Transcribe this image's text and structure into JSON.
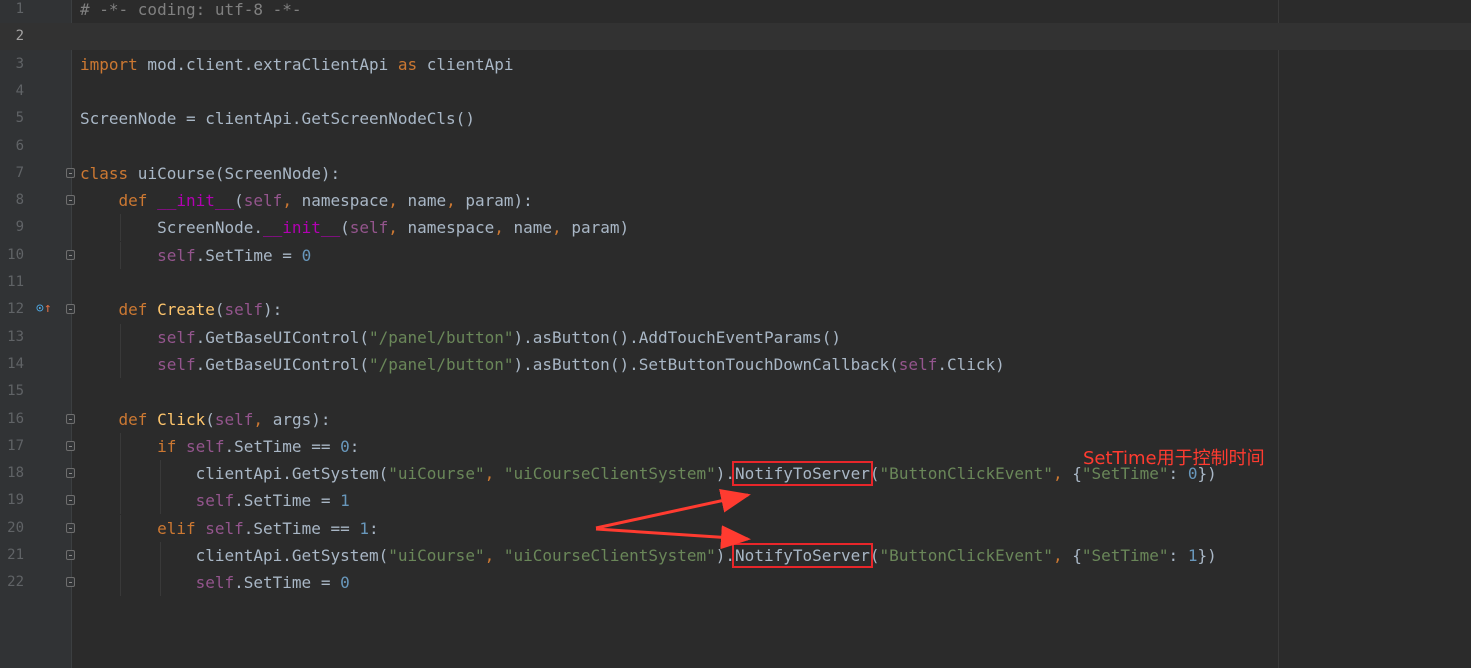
{
  "editor": {
    "current_line": 2,
    "lines": [
      {
        "n": "1",
        "tokens": [
          {
            "t": "cm",
            "v": "# -*- coding: utf-8 -*-"
          }
        ]
      },
      {
        "n": "2",
        "tokens": []
      },
      {
        "n": "3",
        "tokens": [
          {
            "t": "kw",
            "v": "import"
          },
          {
            "t": "",
            "v": " mod.client.extraClientApi "
          },
          {
            "t": "kw",
            "v": "as"
          },
          {
            "t": "",
            "v": " clientApi"
          }
        ]
      },
      {
        "n": "4",
        "tokens": []
      },
      {
        "n": "5",
        "tokens": [
          {
            "t": "",
            "v": "ScreenNode = clientApi.GetScreenNodeCls()"
          }
        ]
      },
      {
        "n": "6",
        "tokens": []
      },
      {
        "n": "7",
        "tokens": [
          {
            "t": "kw",
            "v": "class"
          },
          {
            "t": "",
            "v": " uiCourse(ScreenNode):"
          }
        ]
      },
      {
        "n": "8",
        "tokens": [
          {
            "t": "",
            "v": "    "
          },
          {
            "t": "kw",
            "v": "def"
          },
          {
            "t": "",
            "v": " "
          },
          {
            "t": "dn",
            "v": "__init__"
          },
          {
            "t": "",
            "v": "("
          },
          {
            "t": "sf",
            "v": "self"
          },
          {
            "t": "kw",
            "v": ","
          },
          {
            "t": "",
            "v": " namespace"
          },
          {
            "t": "kw",
            "v": ","
          },
          {
            "t": "",
            "v": " name"
          },
          {
            "t": "kw",
            "v": ","
          },
          {
            "t": "",
            "v": " param):"
          }
        ]
      },
      {
        "n": "9",
        "tokens": [
          {
            "t": "",
            "v": "        ScreenNode."
          },
          {
            "t": "dn",
            "v": "__init__"
          },
          {
            "t": "",
            "v": "("
          },
          {
            "t": "sf",
            "v": "self"
          },
          {
            "t": "kw",
            "v": ","
          },
          {
            "t": "",
            "v": " namespace"
          },
          {
            "t": "kw",
            "v": ","
          },
          {
            "t": "",
            "v": " name"
          },
          {
            "t": "kw",
            "v": ","
          },
          {
            "t": "",
            "v": " param)"
          }
        ]
      },
      {
        "n": "10",
        "tokens": [
          {
            "t": "",
            "v": "        "
          },
          {
            "t": "sf",
            "v": "self"
          },
          {
            "t": "",
            "v": ".SetTime = "
          },
          {
            "t": "nu",
            "v": "0"
          }
        ]
      },
      {
        "n": "11",
        "tokens": []
      },
      {
        "n": "12",
        "tokens": [
          {
            "t": "",
            "v": "    "
          },
          {
            "t": "kw",
            "v": "def"
          },
          {
            "t": "",
            "v": " "
          },
          {
            "t": "fn",
            "v": "Create"
          },
          {
            "t": "",
            "v": "("
          },
          {
            "t": "sf",
            "v": "self"
          },
          {
            "t": "",
            "v": "):"
          }
        ]
      },
      {
        "n": "13",
        "tokens": [
          {
            "t": "",
            "v": "        "
          },
          {
            "t": "sf",
            "v": "self"
          },
          {
            "t": "",
            "v": ".GetBaseUIControl("
          },
          {
            "t": "st",
            "v": "\"/panel/button\""
          },
          {
            "t": "",
            "v": ").asButton().AddTouchEventParams()"
          }
        ]
      },
      {
        "n": "14",
        "tokens": [
          {
            "t": "",
            "v": "        "
          },
          {
            "t": "sf",
            "v": "self"
          },
          {
            "t": "",
            "v": ".GetBaseUIControl("
          },
          {
            "t": "st",
            "v": "\"/panel/button\""
          },
          {
            "t": "",
            "v": ").asButton().SetButtonTouchDownCallback("
          },
          {
            "t": "sf",
            "v": "self"
          },
          {
            "t": "",
            "v": ".Click)"
          }
        ]
      },
      {
        "n": "15",
        "tokens": []
      },
      {
        "n": "16",
        "tokens": [
          {
            "t": "",
            "v": "    "
          },
          {
            "t": "kw",
            "v": "def"
          },
          {
            "t": "",
            "v": " "
          },
          {
            "t": "fn",
            "v": "Click"
          },
          {
            "t": "",
            "v": "("
          },
          {
            "t": "sf",
            "v": "self"
          },
          {
            "t": "kw",
            "v": ","
          },
          {
            "t": "",
            "v": " args):"
          }
        ]
      },
      {
        "n": "17",
        "tokens": [
          {
            "t": "",
            "v": "        "
          },
          {
            "t": "kw",
            "v": "if"
          },
          {
            "t": "",
            "v": " "
          },
          {
            "t": "sf",
            "v": "self"
          },
          {
            "t": "",
            "v": ".SetTime == "
          },
          {
            "t": "nu",
            "v": "0"
          },
          {
            "t": "",
            "v": ":"
          }
        ]
      },
      {
        "n": "18",
        "tokens": [
          {
            "t": "",
            "v": "            clientApi.GetSystem("
          },
          {
            "t": "st",
            "v": "\"uiCourse\""
          },
          {
            "t": "kw",
            "v": ","
          },
          {
            "t": "",
            "v": " "
          },
          {
            "t": "st",
            "v": "\"uiCourseClientSystem\""
          },
          {
            "t": "",
            "v": ")."
          },
          {
            "t": "hl",
            "v": "NotifyToServer"
          },
          {
            "t": "",
            "v": "("
          },
          {
            "t": "st",
            "v": "\"ButtonClickEvent\""
          },
          {
            "t": "kw",
            "v": ","
          },
          {
            "t": "",
            "v": " {"
          },
          {
            "t": "st",
            "v": "\"SetTime\""
          },
          {
            "t": "",
            "v": ": "
          },
          {
            "t": "nu",
            "v": "0"
          },
          {
            "t": "",
            "v": "})"
          }
        ]
      },
      {
        "n": "19",
        "tokens": [
          {
            "t": "",
            "v": "            "
          },
          {
            "t": "sf",
            "v": "self"
          },
          {
            "t": "",
            "v": ".SetTime = "
          },
          {
            "t": "nu",
            "v": "1"
          }
        ]
      },
      {
        "n": "20",
        "tokens": [
          {
            "t": "",
            "v": "        "
          },
          {
            "t": "kw",
            "v": "elif"
          },
          {
            "t": "",
            "v": " "
          },
          {
            "t": "sf",
            "v": "self"
          },
          {
            "t": "",
            "v": ".SetTime == "
          },
          {
            "t": "nu",
            "v": "1"
          },
          {
            "t": "",
            "v": ":"
          }
        ]
      },
      {
        "n": "21",
        "tokens": [
          {
            "t": "",
            "v": "            clientApi.GetSystem("
          },
          {
            "t": "st",
            "v": "\"uiCourse\""
          },
          {
            "t": "kw",
            "v": ","
          },
          {
            "t": "",
            "v": " "
          },
          {
            "t": "st",
            "v": "\"uiCourseClientSystem\""
          },
          {
            "t": "",
            "v": ")."
          },
          {
            "t": "hl",
            "v": "NotifyToServer"
          },
          {
            "t": "",
            "v": "("
          },
          {
            "t": "st",
            "v": "\"ButtonClickEvent\""
          },
          {
            "t": "kw",
            "v": ","
          },
          {
            "t": "",
            "v": " {"
          },
          {
            "t": "st",
            "v": "\"SetTime\""
          },
          {
            "t": "",
            "v": ": "
          },
          {
            "t": "nu",
            "v": "1"
          },
          {
            "t": "",
            "v": "})"
          }
        ]
      },
      {
        "n": "22",
        "tokens": [
          {
            "t": "",
            "v": "            "
          },
          {
            "t": "sf",
            "v": "self"
          },
          {
            "t": "",
            "v": ".SetTime = "
          },
          {
            "t": "nu",
            "v": "0"
          }
        ]
      }
    ],
    "fold_lines": [
      "7",
      "8",
      "10",
      "12",
      "16",
      "17",
      "18",
      "19",
      "20",
      "21",
      "22"
    ],
    "gutter_icon": {
      "line": "12",
      "name": "override-method-icon",
      "glyph": "⊙",
      "arrow": "↑"
    }
  },
  "annotation": {
    "label": "SetTime用于控制时间",
    "color": "#ff3b30"
  },
  "theme": {
    "background": "#2b2b2b",
    "gutter": "#313335",
    "keyword": "#cc7832",
    "self": "#94558d",
    "function": "#ffc66d",
    "dunder": "#b200b2",
    "string": "#6a8759",
    "number": "#6897bb",
    "comment": "#808080",
    "highlight_box": "#e8262a"
  }
}
